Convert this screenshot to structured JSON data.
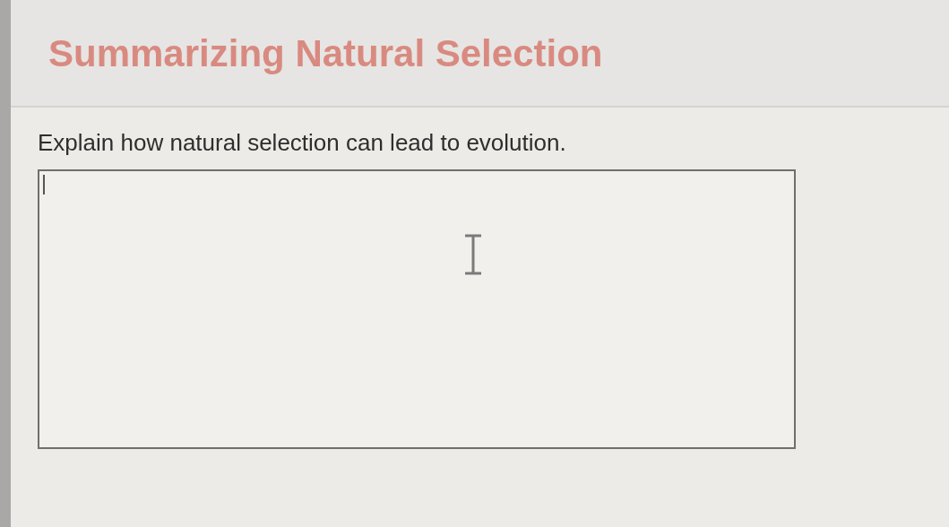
{
  "header": {
    "title": "Summarizing Natural Selection"
  },
  "question": {
    "prompt": "Explain how natural selection can lead to evolution.",
    "answer": {
      "focused": true
    }
  }
}
